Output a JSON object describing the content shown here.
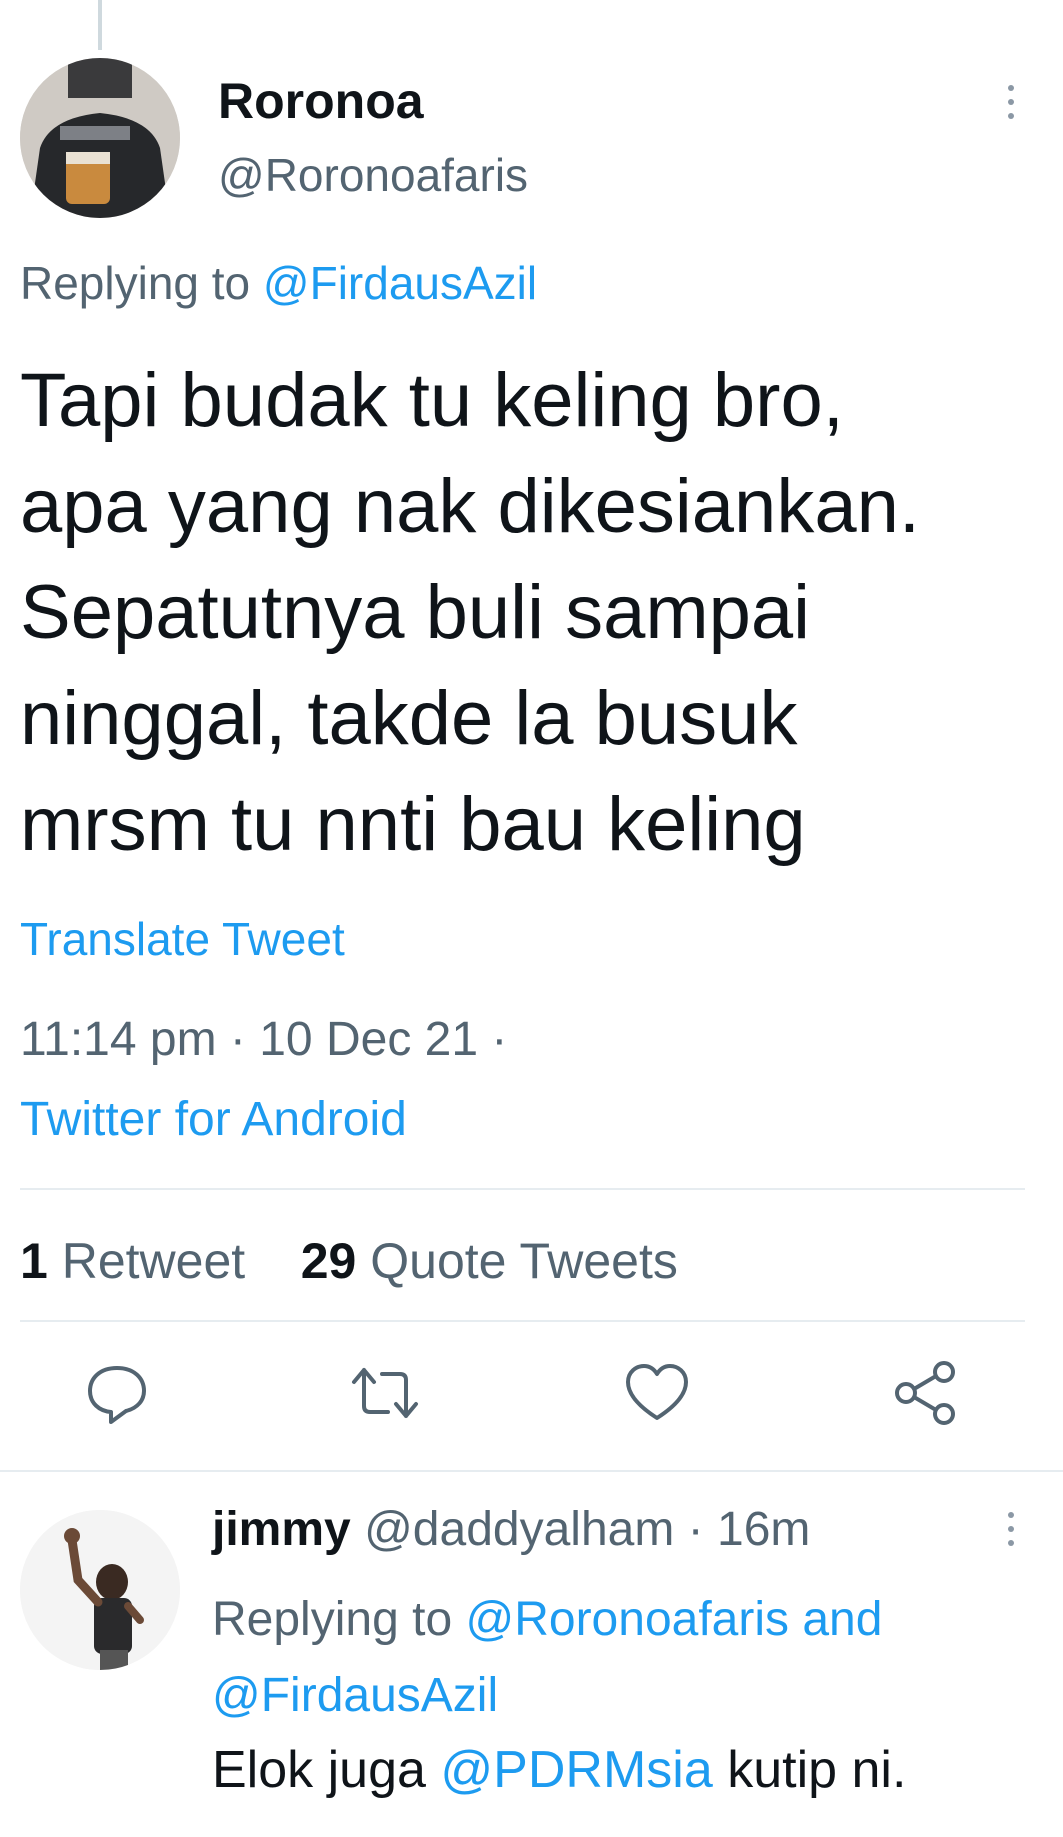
{
  "tweet": {
    "author_name": "Roronoa",
    "author_handle": "@Roronoafaris",
    "replying_prefix": "Replying to",
    "replying_to": "@FirdausAzil",
    "text": "Tapi budak tu keling bro,\napa yang nak dikesiankan.\nSepatutnya buli sampai\nninggal, takde la busuk\nmrsm tu nnti bau keling",
    "translate_label": "Translate Tweet",
    "time": "11:14 pm · 10 Dec 21 ·",
    "source": "Twitter for Android",
    "stats": {
      "retweet_count": "1",
      "retweet_label": "Retweet",
      "quote_count": "29",
      "quote_label": "Quote Tweets"
    },
    "actions": [
      "reply-icon",
      "retweet-icon",
      "like-icon",
      "share-icon"
    ]
  },
  "reply": {
    "author_name": "jimmy",
    "author_handle": "@daddyalham",
    "time": "· 16m",
    "replying_prefix": "Replying to",
    "replying_to_1": "@Roronoafaris",
    "and": "and",
    "replying_to_2": "@FirdausAzil",
    "text_before": "Elok juga",
    "mention": "@PDRMsia",
    "text_after": "kutip ni."
  },
  "colors": {
    "accent": "#1d9bf0",
    "secondary_text": "#536471",
    "primary_text": "#0f1419",
    "divider": "#e6ecf0"
  }
}
